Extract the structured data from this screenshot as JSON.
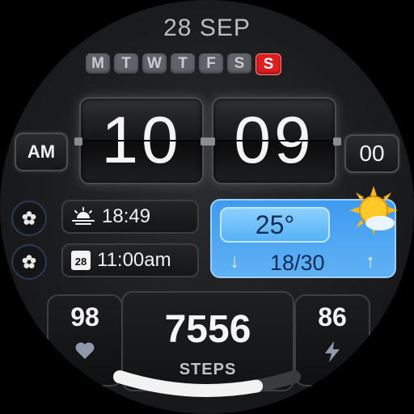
{
  "date": "28 SEP",
  "weekdays": [
    "M",
    "T",
    "W",
    "T",
    "F",
    "S",
    "S"
  ],
  "active_weekday_index": 6,
  "time": {
    "hours": "10",
    "minutes": "09",
    "seconds": "00",
    "period": "AM"
  },
  "sunset_time": "18:49",
  "event_time": "11:00am",
  "calendar_icon_day": "28",
  "weather": {
    "temperature": "25°",
    "range": "18/30",
    "condition_icon": "sun-cloud-icon",
    "down_arrow": "↓",
    "up_arrow": "↑"
  },
  "heart_rate": "98",
  "battery": "86",
  "steps": {
    "count": "7556",
    "label": "STEPS",
    "progress": 0.78
  },
  "colors": {
    "accent_red": "#e11d1d",
    "weather_blue": "#4aa5f2",
    "day_gray": "#5f6368"
  },
  "icons": {
    "left_button_1": "flower-icon",
    "left_button_2": "flower-icon",
    "sunset": "sunset-icon",
    "calendar": "calendar-icon",
    "heart": "heart-icon",
    "bolt": "bolt-icon"
  }
}
